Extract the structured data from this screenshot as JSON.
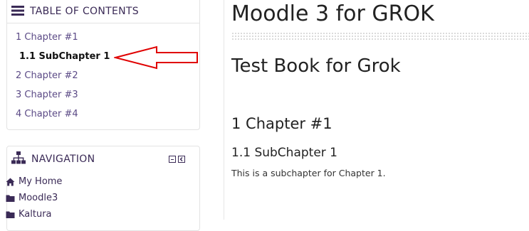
{
  "toc": {
    "title": "TABLE OF CONTENTS",
    "items": [
      {
        "label": "1 Chapter #1"
      },
      {
        "label": "1.1 SubChapter 1",
        "active": true
      },
      {
        "label": "2 Chapter #2"
      },
      {
        "label": "3 Chapter #3"
      },
      {
        "label": "4 Chapter #4"
      }
    ]
  },
  "navigation": {
    "title": "NAVIGATION",
    "items": [
      {
        "label": "My Home",
        "icon": "home-icon"
      },
      {
        "label": "Moodle3",
        "icon": "folder-icon"
      },
      {
        "label": "Kaltura",
        "icon": "folder-icon"
      }
    ]
  },
  "main": {
    "page_title": "Moodle 3 for GROK",
    "book_title": "Test Book for Grok",
    "chapter_title": "1 Chapter #1",
    "subchapter_title": "1.1 SubChapter 1",
    "body": "This is a subchapter for Chapter 1."
  },
  "colors": {
    "accent": "#3a2a56",
    "link": "#5b4a86",
    "annotation_arrow": "#e00000"
  }
}
